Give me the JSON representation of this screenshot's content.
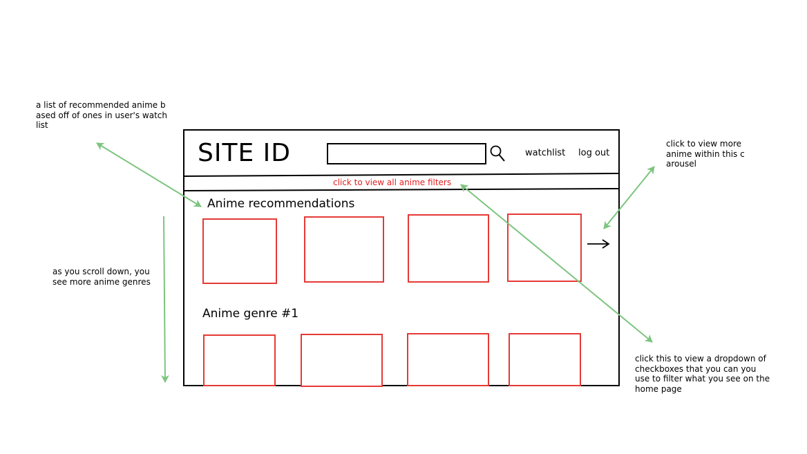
{
  "annotations": {
    "recommended_note": [
      "a list of recommended anime b",
      "ased off of ones in user's watch",
      "list"
    ],
    "scroll_note": [
      "as you scroll down, you",
      "see more anime genres"
    ],
    "carousel_note": [
      "click to view more",
      "anime within this c",
      "arousel"
    ],
    "filter_note": [
      "click this to view a dropdown of",
      "checkboxes that you can you",
      "use to filter what you see on the",
      "home page"
    ]
  },
  "header": {
    "site_title": "SITE ID",
    "search_icon": "search-icon",
    "watchlist_label": "watchlist",
    "logout_label": "log out"
  },
  "filter_bar": {
    "label": "click to view all anime filters",
    "color": "#e02020"
  },
  "sections": [
    {
      "title": "Anime recommendations",
      "card_count": 4
    },
    {
      "title": "Anime genre #1",
      "card_count": 4
    }
  ],
  "colors": {
    "card_border": "#e53935",
    "annotation_arrow": "#7dc47f",
    "frame": "#000000"
  }
}
